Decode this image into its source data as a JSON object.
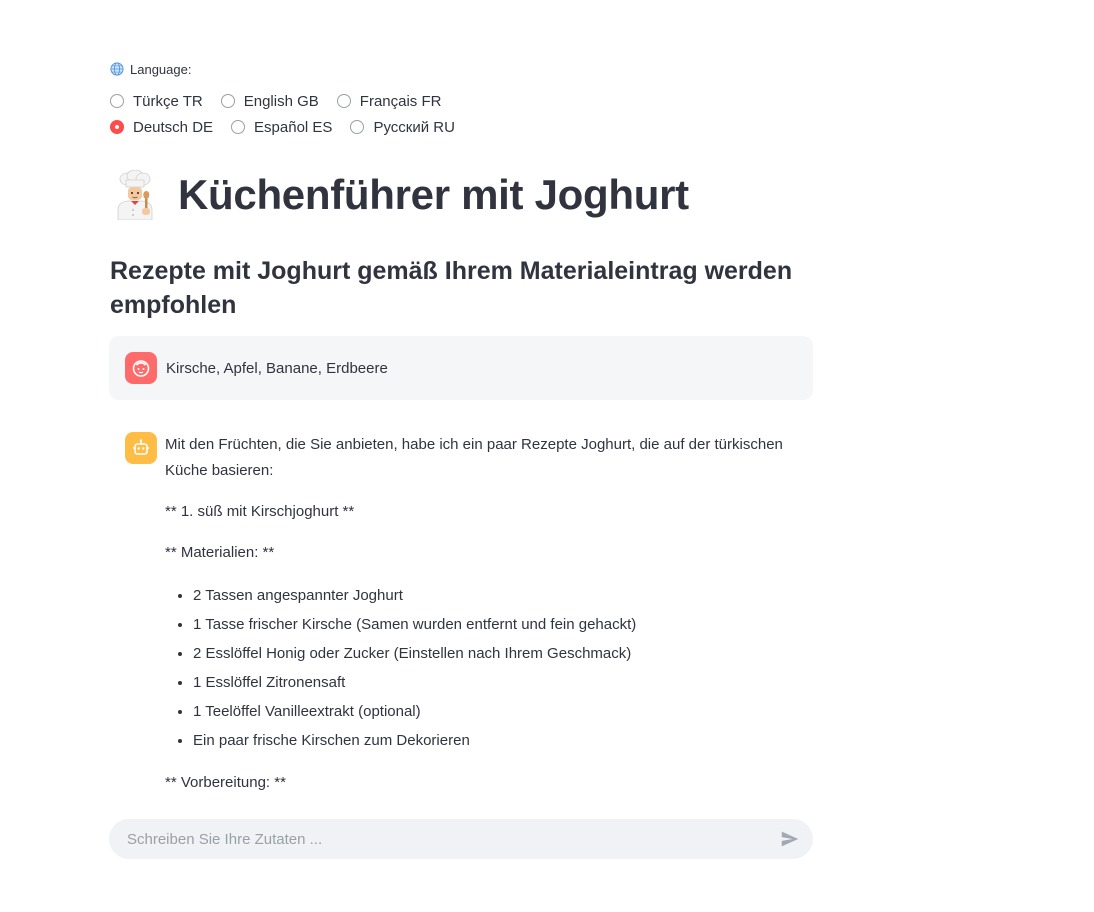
{
  "language": {
    "label": "Language:",
    "rows": [
      [
        {
          "label": "Türkçe TR",
          "selected": false
        },
        {
          "label": "English GB",
          "selected": false
        },
        {
          "label": "Français FR",
          "selected": false
        }
      ],
      [
        {
          "label": "Deutsch DE",
          "selected": true
        },
        {
          "label": "Español ES",
          "selected": false
        },
        {
          "label": "Русский RU",
          "selected": false
        }
      ]
    ]
  },
  "page": {
    "title": "Küchenführer mit Joghurt",
    "subtitle": "Rezepte mit Joghurt gemäß Ihrem Materialeintrag werden empfohlen"
  },
  "chat": {
    "user_message": "Kirsche, Apfel, Banane, Erdbeere",
    "bot": {
      "intro": "Mit den Früchten, die Sie anbieten, habe ich ein paar Rezepte Joghurt, die auf der türkischen Küche basieren:",
      "recipe_heading": "** 1. süß mit Kirschjoghurt **",
      "materials_heading": "** Materialien: **",
      "ingredients": [
        "2 Tassen angespannter Joghurt",
        "1 Tasse frischer Kirsche (Samen wurden entfernt und fein gehackt)",
        "2 Esslöffel Honig oder Zucker (Einstellen nach Ihrem Geschmack)",
        "1 Esslöffel Zitronensaft",
        "1 Teelöffel Vanilleextrakt (optional)",
        "Ein paar frische Kirschen zum Dekorieren"
      ],
      "preparation_heading": "** Vorbereitung: **"
    },
    "input_placeholder": "Schreiben Sie Ihre Zutaten ..."
  },
  "colors": {
    "accent": "#ff4b4b",
    "user_avatar": "#ff6b6b",
    "bot_avatar": "#ffbd45"
  }
}
